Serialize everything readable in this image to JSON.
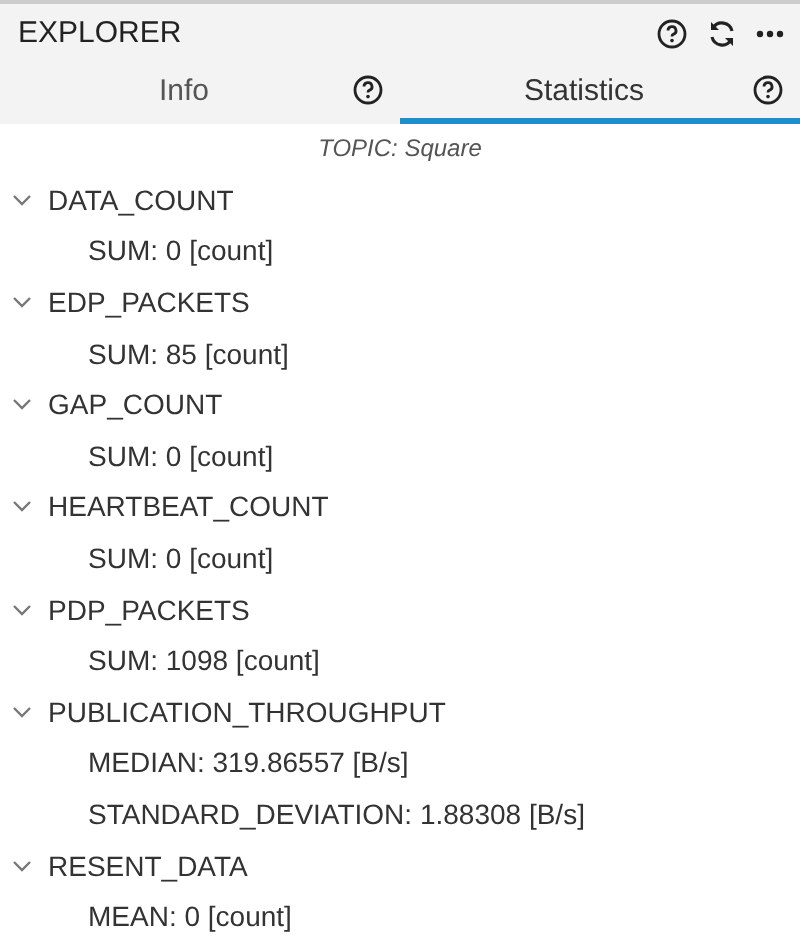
{
  "panel": {
    "title": "EXPLORER"
  },
  "tabs": [
    {
      "label": "Info",
      "selected": false
    },
    {
      "label": "Statistics",
      "selected": true
    }
  ],
  "topic": "TOPIC: Square",
  "tree": [
    {
      "label": "DATA_COUNT",
      "expanded": true,
      "children": [
        {
          "label": "SUM: 0 [count]"
        }
      ]
    },
    {
      "label": "EDP_PACKETS",
      "expanded": true,
      "children": [
        {
          "label": "SUM: 85 [count]"
        }
      ]
    },
    {
      "label": "GAP_COUNT",
      "expanded": true,
      "children": [
        {
          "label": "SUM: 0 [count]"
        }
      ]
    },
    {
      "label": "HEARTBEAT_COUNT",
      "expanded": true,
      "children": [
        {
          "label": "SUM: 0 [count]"
        }
      ]
    },
    {
      "label": "PDP_PACKETS",
      "expanded": true,
      "children": [
        {
          "label": "SUM: 1098 [count]"
        }
      ]
    },
    {
      "label": "PUBLICATION_THROUGHPUT",
      "expanded": true,
      "children": [
        {
          "label": "MEDIAN: 319.86557 [B/s]"
        },
        {
          "label": "STANDARD_DEVIATION: 1.88308 [B/s]"
        }
      ]
    },
    {
      "label": "RESENT_DATA",
      "expanded": true,
      "children": [
        {
          "label": "MEAN: 0 [count]"
        }
      ]
    }
  ]
}
